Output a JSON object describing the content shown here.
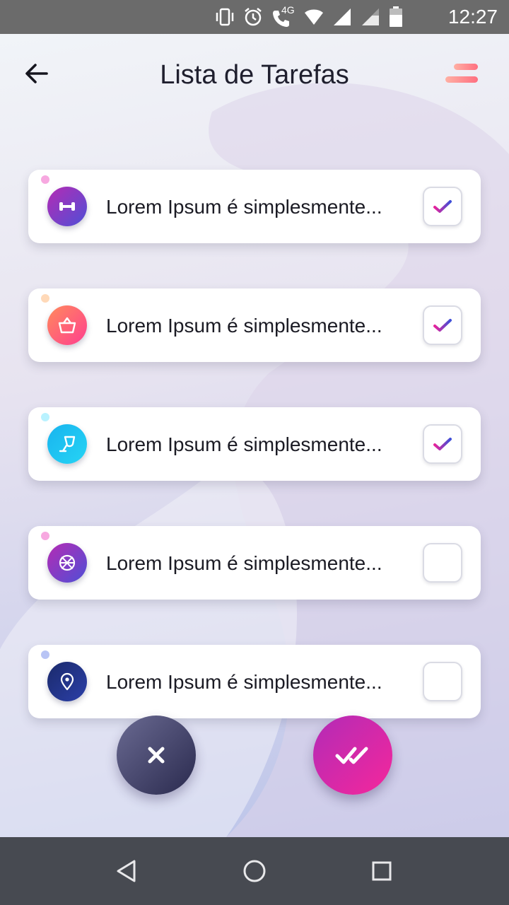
{
  "status_bar": {
    "time": "12:27",
    "network_label": "4G",
    "icons": [
      "vibrate-icon",
      "alarm-icon",
      "volte-call-icon",
      "wifi-icon",
      "signal-icon",
      "signal-icon",
      "battery-icon"
    ]
  },
  "header": {
    "title": "Lista de Tarefas",
    "back_icon": "arrow-left-icon",
    "menu_icon": "menu-icon",
    "menu_color_from": "#ff8a7a",
    "menu_color_to": "#ffb3a8"
  },
  "tasks": [
    {
      "label": "Lorem Ipsum é simplesmente...",
      "icon": "dumbbell-icon",
      "checked": true,
      "dot_color": "#f7a8e0",
      "grad_from": "#b52bb4",
      "grad_to": "#4f4fd6"
    },
    {
      "label": "Lorem Ipsum é simplesmente...",
      "icon": "basket-icon",
      "checked": true,
      "dot_color": "#ffd9b8",
      "grad_from": "#ff8a5c",
      "grad_to": "#ff3f8f"
    },
    {
      "label": "Lorem Ipsum é simplesmente...",
      "icon": "wine-glass-icon",
      "checked": true,
      "dot_color": "#b9f2ff",
      "grad_from": "#19b4ef",
      "grad_to": "#26d4f4"
    },
    {
      "label": "Lorem Ipsum é simplesmente...",
      "icon": "basketball-icon",
      "checked": false,
      "dot_color": "#f7a8e0",
      "grad_from": "#b52bb4",
      "grad_to": "#4f4fd6"
    },
    {
      "label": "Lorem Ipsum é simplesmente...",
      "icon": "location-pin-icon",
      "checked": false,
      "dot_color": "#b8c4f5",
      "grad_from": "#1b2a6b",
      "grad_to": "#2b3fa8"
    }
  ],
  "actions": {
    "cancel_icon": "close-icon",
    "confirm_icon": "double-check-icon",
    "cancel_color_from": "#6a6a92",
    "cancel_color_to": "#2a2a4e",
    "confirm_color_from": "#b22bb7",
    "confirm_color_to": "#f5279b"
  },
  "nav_bar": {
    "buttons": [
      "nav-back-icon",
      "nav-home-icon",
      "nav-recents-icon"
    ]
  },
  "colors": {
    "check_from": "#e8239b",
    "check_to": "#3e4fd8"
  }
}
